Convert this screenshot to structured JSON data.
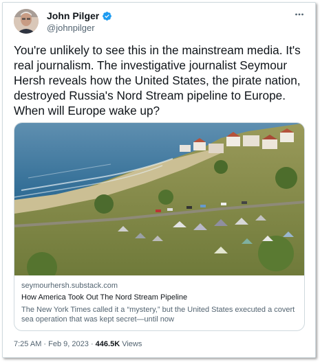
{
  "author": {
    "name": "John Pilger",
    "handle": "@johnpilger"
  },
  "tweet": {
    "text": "You're unlikely to see this in the mainstream media. It's real journalism. The investigative journalist Seymour Hersh reveals how the United States, the pirate nation, destroyed Russia's Nord Stream pipeline to Europe. When will Europe wake up?"
  },
  "card": {
    "domain": "seymourhersh.substack.com",
    "title": "How America Took Out The Nord Stream Pipeline",
    "description": "The New York Times called it a “mystery,” but the United States executed a covert sea operation that was kept secret—until now"
  },
  "meta": {
    "time": "7:25 AM",
    "separator": "·",
    "date": "Feb 9, 2023",
    "views_count": "446.5K",
    "views_label": "Views"
  },
  "colors": {
    "verified": "#1d9bf0",
    "secondary_text": "#536471",
    "border": "#cfd9de"
  },
  "icons": {
    "verified": "verified-badge-icon",
    "more": "more-options-icon"
  }
}
